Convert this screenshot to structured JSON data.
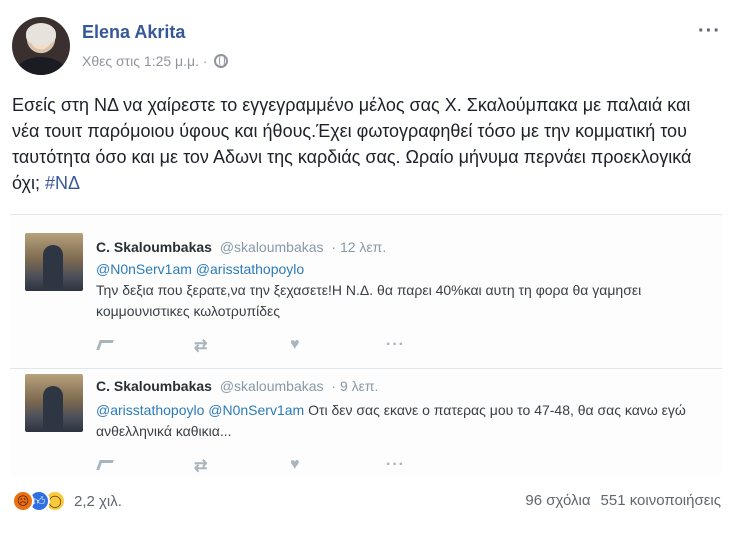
{
  "post": {
    "author": "Elena Akrita",
    "timestamp": "Χθες στις 1:25 μ.μ. ·",
    "privacy_icon": "globe-icon",
    "more_label": "···",
    "text_main": "Εσείς στη ΝΔ να χαίρεστε το εγγεγραμμένο μέλος σας Χ. Σκαλούμπακα με παλαιά και νέα τουιτ παρόμοιου ύφους και ήθους.Έχει φωτογραφηθεί τόσο με την κομματική του ταυτότητα όσο και με τον Αδωνι της καρδιάς σας. Ωραίο μήνυμα περνάει προεκλογικά όχι; ",
    "hashtag": "#ΝΔ"
  },
  "embed": {
    "tweets": [
      {
        "name": "C. Skaloumbakas",
        "handle": "@skaloumbakas",
        "time": "· 12 λεπ.",
        "mentions": "@N0nServ1am @arisstathopoylo",
        "text": "Την δεξια που ξερατε,να την ξεχασετε!Η Ν.Δ. θα παρει 40%και αυτη τη φορα θα γαμησει κομμουνιστικες κωλοτρυπίδες"
      },
      {
        "name": "C. Skaloumbakas",
        "handle": "@skaloumbakas",
        "time": "· 9 λεπ.",
        "mentions": "@arisstathopoylo @N0nServ1am",
        "text": " Οτι δεν σας εκανε ο πατερας μου το 47-48, θα σας κανω εγώ ανθελληνικά καθικια..."
      }
    ],
    "action_icons": [
      "reply-icon",
      "retweet-icon",
      "heart-icon",
      "more-dots-icon"
    ],
    "retweet_glyph": "⇄",
    "heart_glyph": "♥",
    "dots_glyph": "···"
  },
  "footer": {
    "reaction_icons": [
      "angry-icon",
      "like-icon",
      "wow-icon"
    ],
    "reaction_count": "2,2 χιλ.",
    "comments": "96 σχόλια",
    "shares": "551 κοινοποιήσεις"
  }
}
